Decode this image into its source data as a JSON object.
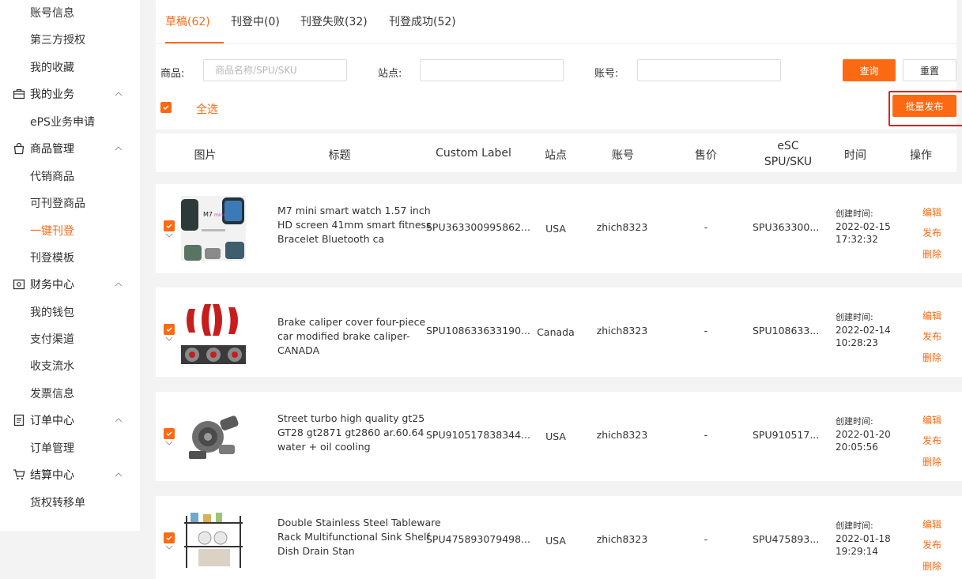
{
  "sidebar": {
    "top_items": [
      "账号信息",
      "第三方授权",
      "我的收藏"
    ],
    "groups": [
      {
        "label": "我的业务",
        "icon": "briefcase-icon",
        "items": [
          "ePS业务申请"
        ]
      },
      {
        "label": "商品管理",
        "icon": "shopping-bag-icon",
        "items": [
          "代销商品",
          "可刊登商品",
          "一键刊登",
          "刊登模板"
        ]
      },
      {
        "label": "财务中心",
        "icon": "wallet-icon",
        "items": [
          "我的钱包",
          "支付渠道",
          "收支流水",
          "发票信息"
        ]
      },
      {
        "label": "订单中心",
        "icon": "document-icon",
        "items": [
          "订单管理"
        ]
      },
      {
        "label": "结算中心",
        "icon": "cart-icon",
        "items": [
          "货权转移单"
        ]
      }
    ],
    "active_item": "一键刊登"
  },
  "tabs": [
    "草稿(62)",
    "刊登中(0)",
    "刊登失败(32)",
    "刊登成功(52)"
  ],
  "filters": {
    "product_label": "商品:",
    "product_placeholder": "商品名称/SPU/SKU",
    "site_label": "站点:",
    "account_label": "账号:",
    "query_button": "查询",
    "reset_button": "重置"
  },
  "select_all_label": "全选",
  "batch_publish_button": "批量发布",
  "columns": [
    "图片",
    "标题",
    "Custom Label",
    "站点",
    "账号",
    "售价",
    "eSC SPU/SKU",
    "时间",
    "操作"
  ],
  "time_prefix": "创建时间:",
  "actions": [
    "编辑",
    "发布",
    "删除"
  ],
  "rows": [
    {
      "title": "M7 mini smart watch 1.57 inch HD screen 41mm smart fitness Bracelet Bluetooth ca",
      "custom_label": "SPU363300995862...",
      "site": "USA",
      "account": "zhich8323",
      "price": "-",
      "esc_sku": "SPU363300...",
      "date": "2022-02-15",
      "time": "17:32:32"
    },
    {
      "title": "Brake caliper cover four-piece car modified brake caliper-CANADA",
      "custom_label": "SPU108633633190...",
      "site": "Canada",
      "account": "zhich8323",
      "price": "-",
      "esc_sku": "SPU108633...",
      "date": "2022-02-14",
      "time": "10:28:23"
    },
    {
      "title": "Street turbo high quality gt25 GT28 gt2871 gt2860 ar.60.64 water + oil cooling",
      "custom_label": "SPU910517838344...",
      "site": "USA",
      "account": "zhich8323",
      "price": "-",
      "esc_sku": "SPU910517...",
      "date": "2022-01-20",
      "time": "20:05:56"
    },
    {
      "title": "Double Stainless Steel Tableware Rack Multifunctional Sink Shelf Dish Drain Stan",
      "custom_label": "SPU475893079498...",
      "site": "USA",
      "account": "zhich8323",
      "price": "-",
      "esc_sku": "SPU475893...",
      "date": "2022-01-18",
      "time": "19:29:14"
    }
  ],
  "colors": {
    "accent": "#fb6a13",
    "highlight": "#e0211d"
  }
}
